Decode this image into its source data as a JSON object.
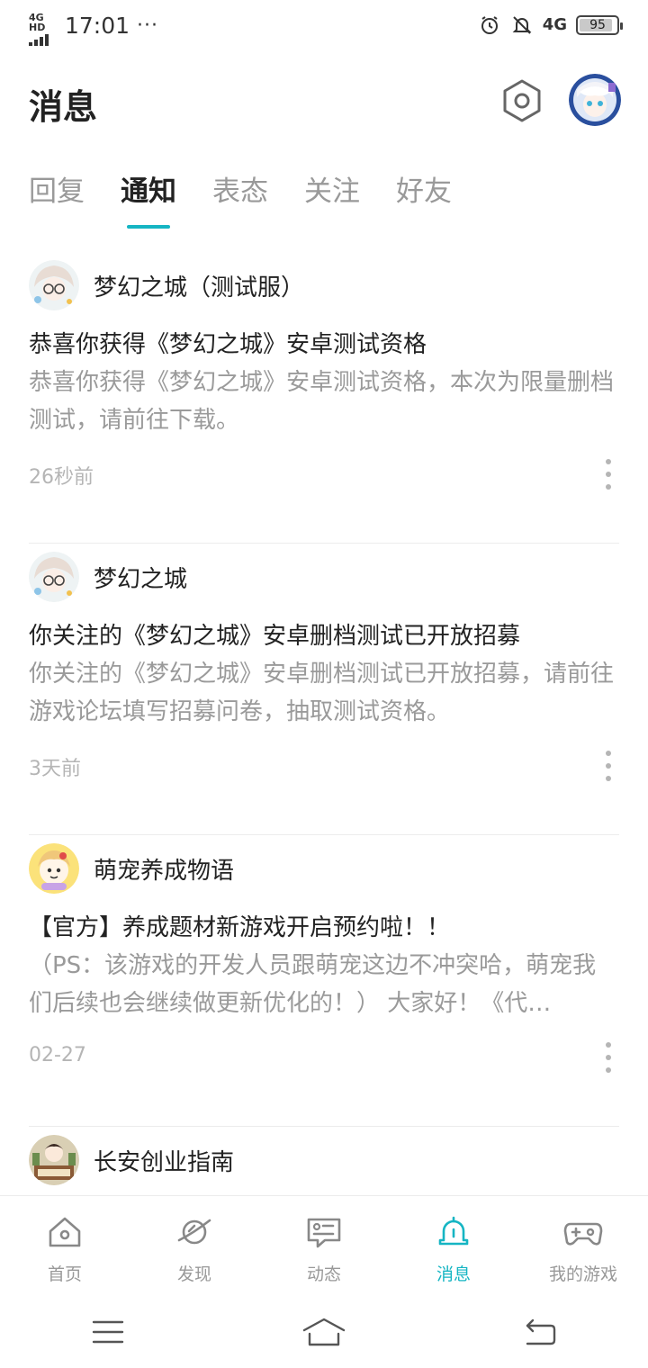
{
  "status_bar": {
    "network_label": "4G HD",
    "time": "17:01",
    "more": "···",
    "cellular": "4G",
    "battery": "95"
  },
  "header": {
    "title": "消息"
  },
  "tabs": [
    {
      "label": "回复",
      "active": false
    },
    {
      "label": "通知",
      "active": true
    },
    {
      "label": "表态",
      "active": false
    },
    {
      "label": "关注",
      "active": false
    },
    {
      "label": "好友",
      "active": false
    }
  ],
  "notifications": [
    {
      "sender": "梦幻之城（测试服）",
      "title": "恭喜你获得《梦幻之城》安卓测试资格",
      "body": "恭喜你获得《梦幻之城》安卓测试资格，本次为限量删档测试，请前往下载。",
      "time": "26秒前"
    },
    {
      "sender": "梦幻之城",
      "title": "你关注的《梦幻之城》安卓删档测试已开放招募",
      "body": "你关注的《梦幻之城》安卓删档测试已开放招募，请前往游戏论坛填写招募问卷，抽取测试资格。",
      "time": "3天前"
    },
    {
      "sender": "萌宠养成物语",
      "title": "【官方】养成题材新游戏开启预约啦！！",
      "body": "（PS：该游戏的开发人员跟萌宠这边不冲突哈，萌宠我们后续也会继续做更新优化的！） 大家好！《代…",
      "time": "02-27"
    },
    {
      "sender": "长安创业指南"
    }
  ],
  "bottom_nav": [
    {
      "label": "首页",
      "icon": "home-icon",
      "active": false
    },
    {
      "label": "发现",
      "icon": "discover-planet-icon",
      "active": false
    },
    {
      "label": "动态",
      "icon": "feed-message-icon",
      "active": false
    },
    {
      "label": "消息",
      "icon": "bell-icon",
      "active": true
    },
    {
      "label": "我的游戏",
      "icon": "gamepad-icon",
      "active": false
    }
  ],
  "colors": {
    "accent": "#15b5c3",
    "text_primary": "#222222",
    "text_secondary": "#9a9a9a",
    "divider": "#ececec"
  }
}
